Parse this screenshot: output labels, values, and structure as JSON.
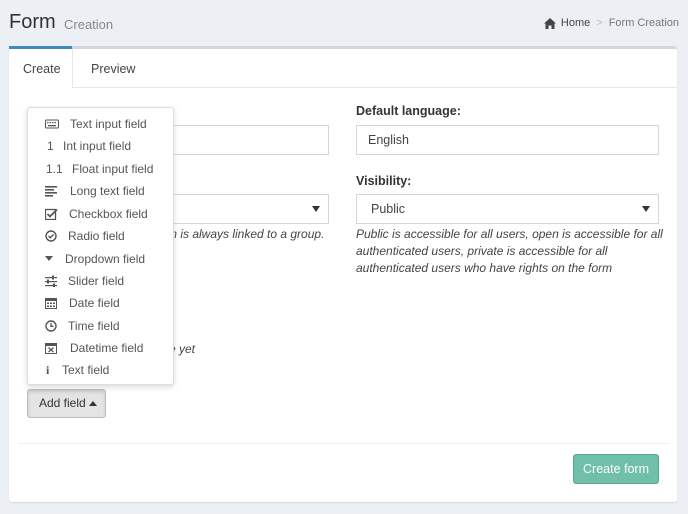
{
  "header": {
    "title": "Form",
    "subtitle": "Creation",
    "breadcrumb": {
      "home": "Home",
      "current": "Form Creation"
    }
  },
  "tabs": [
    {
      "label": "Create"
    },
    {
      "label": "Preview"
    }
  ],
  "form": {
    "default_language_label": "Default language:",
    "default_language_value": "English",
    "visibility_label": "Visibility:",
    "visibility_value": "Public",
    "visibility_help": [
      "Public is accessible for all users, open is accessible for all",
      "authenticated users, private is accessible for all",
      "authenticated users who have rights on the form"
    ],
    "group_help_partial": "rm is always linked to a group.",
    "fields_partial": "e yet"
  },
  "field_menu": [
    {
      "label": "Text input field",
      "icon": "keyboard-icon"
    },
    {
      "label": "Int input field",
      "icon": "int-icon",
      "glyph": "1"
    },
    {
      "label": "Float input field",
      "icon": "float-icon",
      "glyph": "1.1"
    },
    {
      "label": "Long text field",
      "icon": "align-left-icon"
    },
    {
      "label": "Checkbox field",
      "icon": "checkbox-icon"
    },
    {
      "label": "Radio field",
      "icon": "radio-icon"
    },
    {
      "label": "Dropdown field",
      "icon": "caret-down-icon"
    },
    {
      "label": "Slider field",
      "icon": "sliders-icon"
    },
    {
      "label": "Date field",
      "icon": "calendar-icon"
    },
    {
      "label": "Time field",
      "icon": "clock-icon"
    },
    {
      "label": "Datetime field",
      "icon": "calendar-times-icon"
    },
    {
      "label": "Text field",
      "icon": "info-icon",
      "glyph": "i"
    }
  ],
  "buttons": {
    "add_field": "Add field",
    "create_form": "Create form"
  },
  "colors": {
    "accent": "#3c8dbc",
    "create_button": "#6fbfa9",
    "background": "#ecf0f5"
  }
}
